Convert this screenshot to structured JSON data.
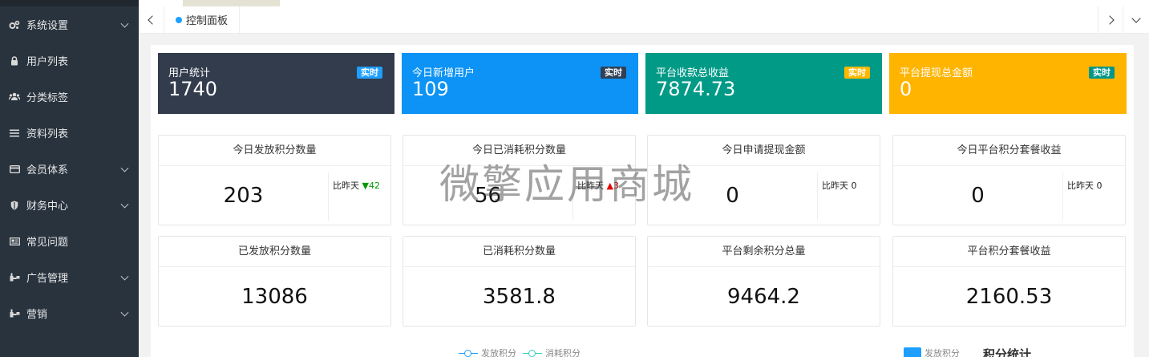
{
  "sidebar": {
    "items": [
      {
        "label": "系统设置",
        "icon": "gears-icon",
        "expandable": true
      },
      {
        "label": "用户列表",
        "icon": "lock-icon",
        "expandable": false
      },
      {
        "label": "分类标签",
        "icon": "users-icon",
        "expandable": false
      },
      {
        "label": "资料列表",
        "icon": "list-icon",
        "expandable": false
      },
      {
        "label": "会员体系",
        "icon": "card-icon",
        "expandable": true
      },
      {
        "label": "财务中心",
        "icon": "shield-icon",
        "expandable": true
      },
      {
        "label": "常见问题",
        "icon": "newspaper-icon",
        "expandable": false
      },
      {
        "label": "广告管理",
        "icon": "sitemap-icon",
        "expandable": true
      },
      {
        "label": "营销",
        "icon": "sitemap-icon",
        "expandable": true
      }
    ]
  },
  "tabs": {
    "active_label": "控制面板"
  },
  "stats": [
    {
      "label": "用户统计",
      "value": "1740",
      "badge": "实时",
      "color": "#323c4d",
      "badge_color": "#1e9fff"
    },
    {
      "label": "今日新增用户",
      "value": "109",
      "badge": "实时",
      "color": "#0c93f5",
      "badge_color": "#2f4056"
    },
    {
      "label": "平台收款总收益",
      "value": "7874.73",
      "badge": "实时",
      "color": "#009a87",
      "badge_color": "#ffb800"
    },
    {
      "label": "平台提现总金额",
      "value": "0",
      "badge": "实时",
      "color": "#ffb400",
      "badge_color": "#009688"
    }
  ],
  "today_cards": [
    {
      "title": "今日发放积分数量",
      "value": "203",
      "compare_label": "比昨天",
      "trend": "down",
      "trend_symbol": "▼",
      "delta": "42"
    },
    {
      "title": "今日已消耗积分数量",
      "value": "56",
      "compare_label": "比昨天",
      "trend": "up",
      "trend_symbol": "▲",
      "delta": "3"
    },
    {
      "title": "今日申请提现金额",
      "value": "0",
      "compare_label": "比昨天",
      "trend": "none",
      "trend_symbol": "",
      "delta": "0"
    },
    {
      "title": "今日平台积分套餐收益",
      "value": "0",
      "compare_label": "比昨天",
      "trend": "none",
      "trend_symbol": "",
      "delta": "0"
    }
  ],
  "total_cards": [
    {
      "title": "已发放积分数量",
      "value": "13086"
    },
    {
      "title": "已消耗积分数量",
      "value": "3581.8"
    },
    {
      "title": "平台剩余积分总量",
      "value": "9464.2"
    },
    {
      "title": "平台积分套餐收益",
      "value": "2160.53"
    }
  ],
  "watermark": "微擎应用商城",
  "chart1": {
    "legend": [
      {
        "name": "发放积分",
        "color": "#1e9fff"
      },
      {
        "name": "消耗积分",
        "color": "#33d0b8"
      }
    ]
  },
  "chart2": {
    "legend_label": "发放积分",
    "legend_color": "#1e9fff",
    "title": "积分统计"
  }
}
